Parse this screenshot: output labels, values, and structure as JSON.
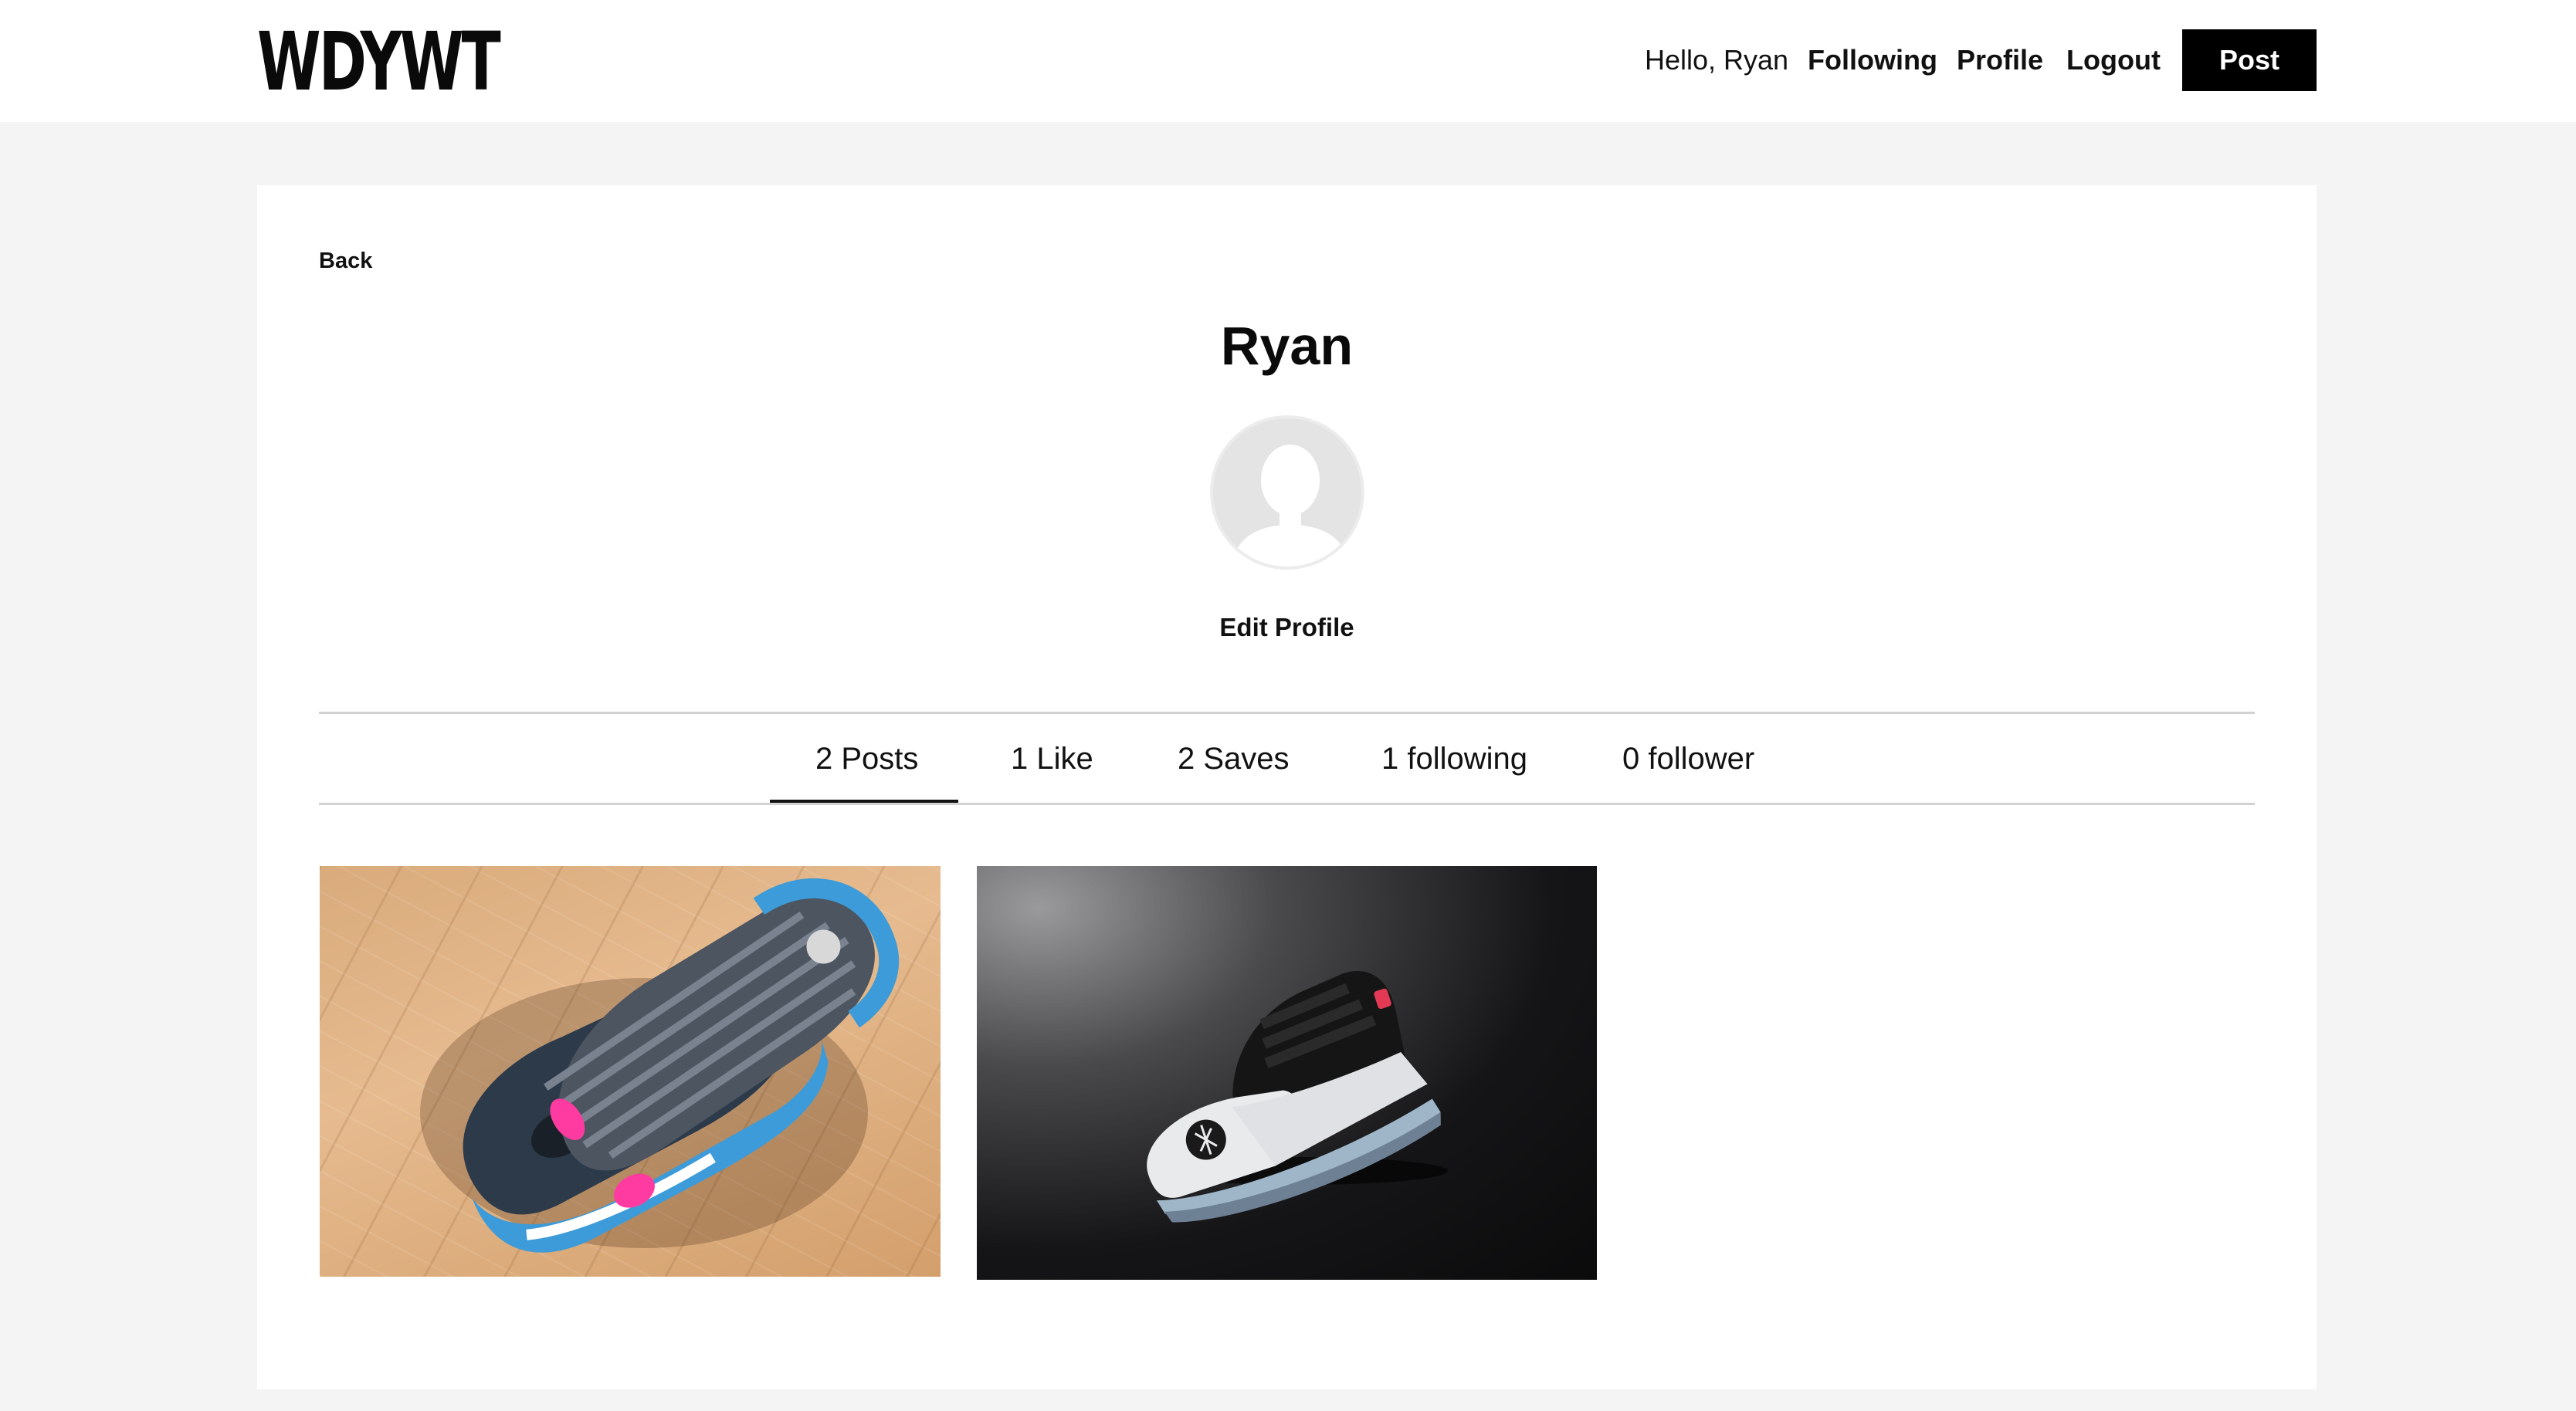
{
  "header": {
    "logo": "WDYWT",
    "greeting": "Hello, Ryan",
    "nav": {
      "following": "Following",
      "profile": "Profile",
      "logout": "Logout"
    },
    "post_button": "Post"
  },
  "profile": {
    "back_label": "Back",
    "name": "Ryan",
    "edit_label": "Edit Profile"
  },
  "stats": {
    "posts": "2 Posts",
    "likes": "1 Like",
    "saves": "2 Saves",
    "following": "1 following",
    "followers": "0 follower",
    "active_tab": "posts"
  },
  "colors": {
    "accent": "#000000",
    "page_bg": "#f4f4f4",
    "card_bg": "#ffffff"
  }
}
